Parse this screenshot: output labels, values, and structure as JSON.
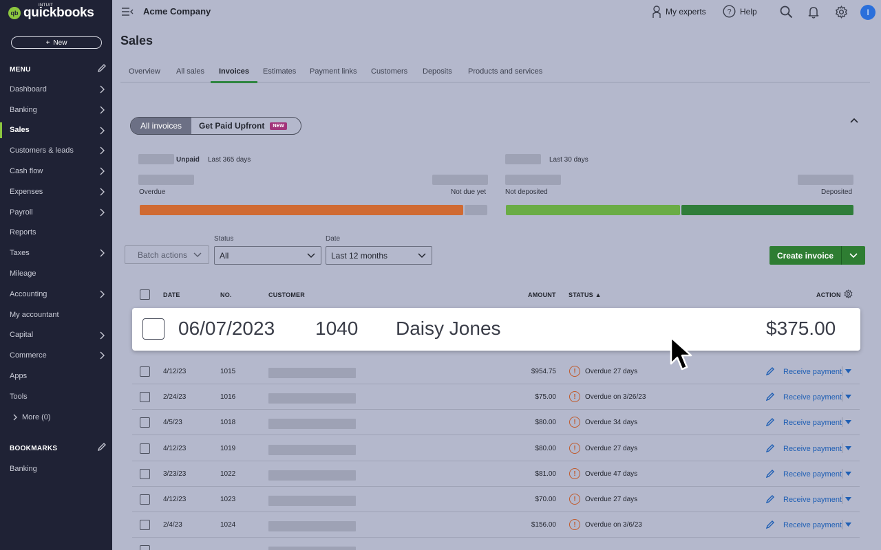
{
  "app": {
    "logo_intuit": "INTUIT",
    "logo_text": "quickbooks",
    "logo_badge": "qb"
  },
  "sidebar": {
    "new_label": "New",
    "menu_heading": "MENU",
    "items": [
      {
        "label": "Dashboard",
        "chevron": true
      },
      {
        "label": "Banking",
        "chevron": true
      },
      {
        "label": "Sales",
        "chevron": true,
        "active": true
      },
      {
        "label": "Customers & leads",
        "chevron": true
      },
      {
        "label": "Cash flow",
        "chevron": true
      },
      {
        "label": "Expenses",
        "chevron": true
      },
      {
        "label": "Payroll",
        "chevron": true
      },
      {
        "label": "Reports",
        "chevron": false
      },
      {
        "label": "Taxes",
        "chevron": true
      },
      {
        "label": "Mileage",
        "chevron": false
      },
      {
        "label": "Accounting",
        "chevron": true
      },
      {
        "label": "My accountant",
        "chevron": false
      },
      {
        "label": "Capital",
        "chevron": true
      },
      {
        "label": "Commerce",
        "chevron": true
      },
      {
        "label": "Apps",
        "chevron": false
      },
      {
        "label": "Tools",
        "chevron": false
      }
    ],
    "more_label": "More (0)",
    "bookmarks_heading": "BOOKMARKS",
    "bookmarks": [
      "Banking"
    ]
  },
  "header": {
    "company": "Acme Company",
    "my_experts": "My experts",
    "help": "Help",
    "avatar_initial": "I"
  },
  "page": {
    "title": "Sales",
    "tabs": [
      "Overview",
      "All sales",
      "Invoices",
      "Estimates",
      "Payment links",
      "Customers",
      "Deposits",
      "Products and services"
    ],
    "active_tab": "Invoices"
  },
  "segment": {
    "all_invoices": "All invoices",
    "get_paid": "Get Paid Upfront",
    "new_badge": "NEW"
  },
  "summary": {
    "unpaid_label": "Unpaid",
    "unpaid_period": "Last 365 days",
    "overdue": "Overdue",
    "not_due_yet": "Not due yet",
    "paid_period": "Last 30 days",
    "not_deposited": "Not deposited",
    "deposited": "Deposited",
    "overdue_fraction": 0.93,
    "not_deposited_fraction": 0.5,
    "colors": {
      "overdue": "#d06a32",
      "not_due": "#9ea2b5",
      "not_deposited": "#6aac45",
      "deposited": "#2f7d3a"
    }
  },
  "filters": {
    "batch_actions": "Batch actions",
    "status_label": "Status",
    "status_value": "All",
    "date_label": "Date",
    "date_value": "Last 12 months",
    "create_invoice": "Create invoice"
  },
  "table": {
    "headers": {
      "date": "DATE",
      "no": "NO.",
      "customer": "CUSTOMER",
      "amount": "AMOUNT",
      "status": "STATUS ▲",
      "action": "ACTION"
    },
    "highlight": {
      "date": "06/07/2023",
      "no": "1040",
      "customer": "Daisy Jones",
      "amount": "$375.00"
    },
    "rows": [
      {
        "date": "4/12/23",
        "no": "1015",
        "amount": "$954.75",
        "status": "Overdue 27 days",
        "action": "Receive payment"
      },
      {
        "date": "2/24/23",
        "no": "1016",
        "amount": "$75.00",
        "status": "Overdue on 3/26/23",
        "action": "Receive payment"
      },
      {
        "date": "4/5/23",
        "no": "1018",
        "amount": "$80.00",
        "status": "Overdue 34 days",
        "action": "Receive payment"
      },
      {
        "date": "4/12/23",
        "no": "1019",
        "amount": "$80.00",
        "status": "Overdue 27 days",
        "action": "Receive payment"
      },
      {
        "date": "3/23/23",
        "no": "1022",
        "amount": "$81.00",
        "status": "Overdue 47 days",
        "action": "Receive payment"
      },
      {
        "date": "4/12/23",
        "no": "1023",
        "amount": "$70.00",
        "status": "Overdue 27 days",
        "action": "Receive payment"
      },
      {
        "date": "2/4/23",
        "no": "1024",
        "amount": "$156.00",
        "status": "Overdue on 3/6/23",
        "action": "Receive payment"
      }
    ]
  }
}
